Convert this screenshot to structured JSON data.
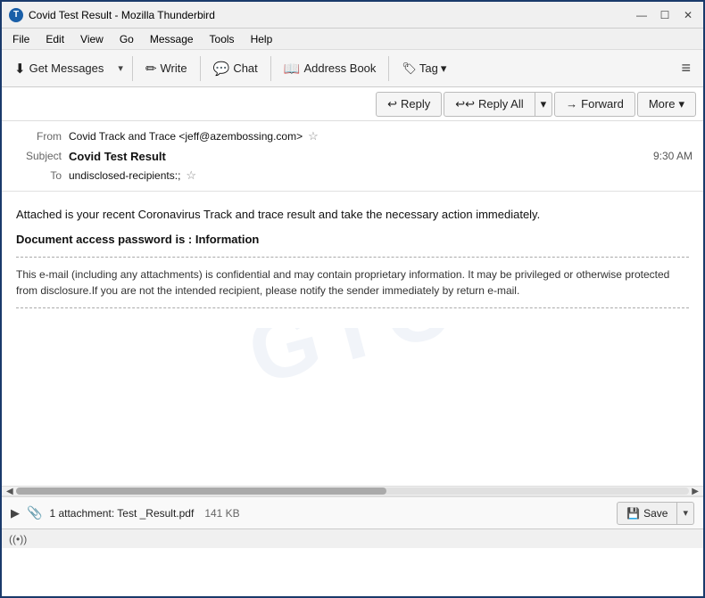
{
  "titleBar": {
    "title": "Covid Test Result - Mozilla Thunderbird",
    "iconLabel": "T",
    "minimizeLabel": "—",
    "maximizeLabel": "☐",
    "closeLabel": "✕"
  },
  "menuBar": {
    "items": [
      "File",
      "Edit",
      "View",
      "Go",
      "Message",
      "Tools",
      "Help"
    ]
  },
  "toolbar": {
    "getMessagesLabel": "Get Messages",
    "writeLabel": "Write",
    "chatLabel": "Chat",
    "addressBookLabel": "Address Book",
    "tagLabel": "Tag",
    "hamburgerLabel": "≡"
  },
  "actionBar": {
    "replyLabel": "Reply",
    "replyAllLabel": "Reply All",
    "forwardLabel": "Forward",
    "moreLabel": "More",
    "replyIcon": "↩",
    "replyAllIcon": "↩↩",
    "forwardIcon": "→",
    "dropdownIcon": "▾"
  },
  "emailHeader": {
    "fromLabel": "From",
    "fromValue": "Covid Track and Trace <jeff@azembossing.com>",
    "subjectLabel": "Subject",
    "subjectValue": "Covid Test Result",
    "timeValue": "9:30 AM",
    "toLabel": "To",
    "toValue": "undisclosed-recipients:;"
  },
  "emailBody": {
    "paragraph1": "Attached is your recent Coronavirus Track and trace result and take the necessary action immediately.",
    "passwordLine": "Document access password is : Information",
    "disclaimer": "This e-mail (including any attachments) is confidential and may contain proprietary information. It may be privileged or otherwise protected from disclosure.If you are not the intended recipient, please notify the sender immediately by return e-mail."
  },
  "attachment": {
    "countText": "1 attachment: Test _Result.pdf",
    "size": "141 KB",
    "saveLabel": "Save",
    "dropdownIcon": "▾",
    "expandIcon": "▶"
  },
  "statusBar": {
    "iconLabel": "((•))",
    "text": ""
  },
  "watermark": {
    "text": "GTC"
  }
}
